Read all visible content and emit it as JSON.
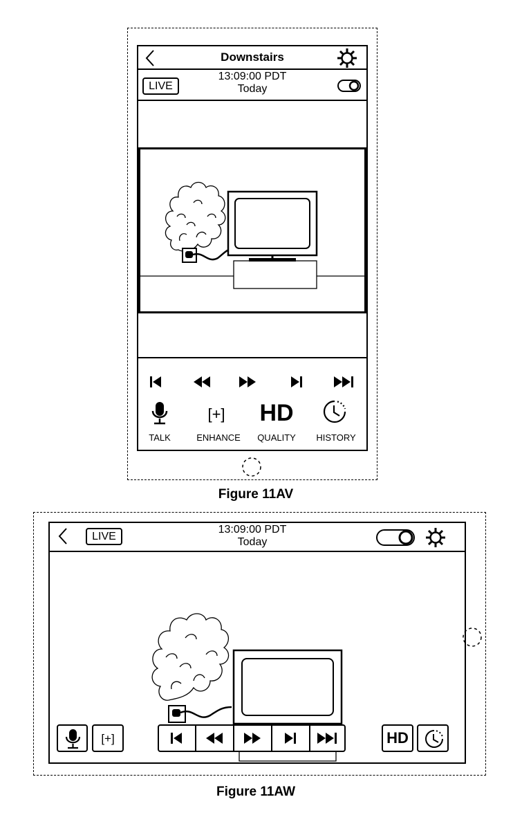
{
  "fig_av": {
    "caption": "Figure 11AV",
    "title": "Downstairs",
    "live": "LIVE",
    "time": "13:09:00 PDT",
    "day": "Today",
    "icons": {
      "back": "chevron-left-icon",
      "settings": "gear-icon",
      "toggle": "toggle-icon",
      "home": "home-button-icon"
    },
    "transport": [
      "skip-to-start-icon",
      "rewind-icon",
      "fast-forward-icon",
      "skip-next-icon",
      "skip-to-end-icon"
    ],
    "actions": [
      {
        "label": "TALK",
        "icon": "microphone-icon"
      },
      {
        "label": "ENHANCE",
        "icon": "enhance-icon",
        "glyph": "[+]"
      },
      {
        "label": "QUALITY",
        "icon": "hd-icon",
        "glyph": "HD"
      },
      {
        "label": "HISTORY",
        "icon": "history-clock-icon"
      }
    ]
  },
  "fig_aw": {
    "caption": "Figure 11AW",
    "live": "LIVE",
    "time": "13:09:00 PDT",
    "day": "Today",
    "enhance_glyph": "[+]",
    "hd_glyph": "HD"
  }
}
